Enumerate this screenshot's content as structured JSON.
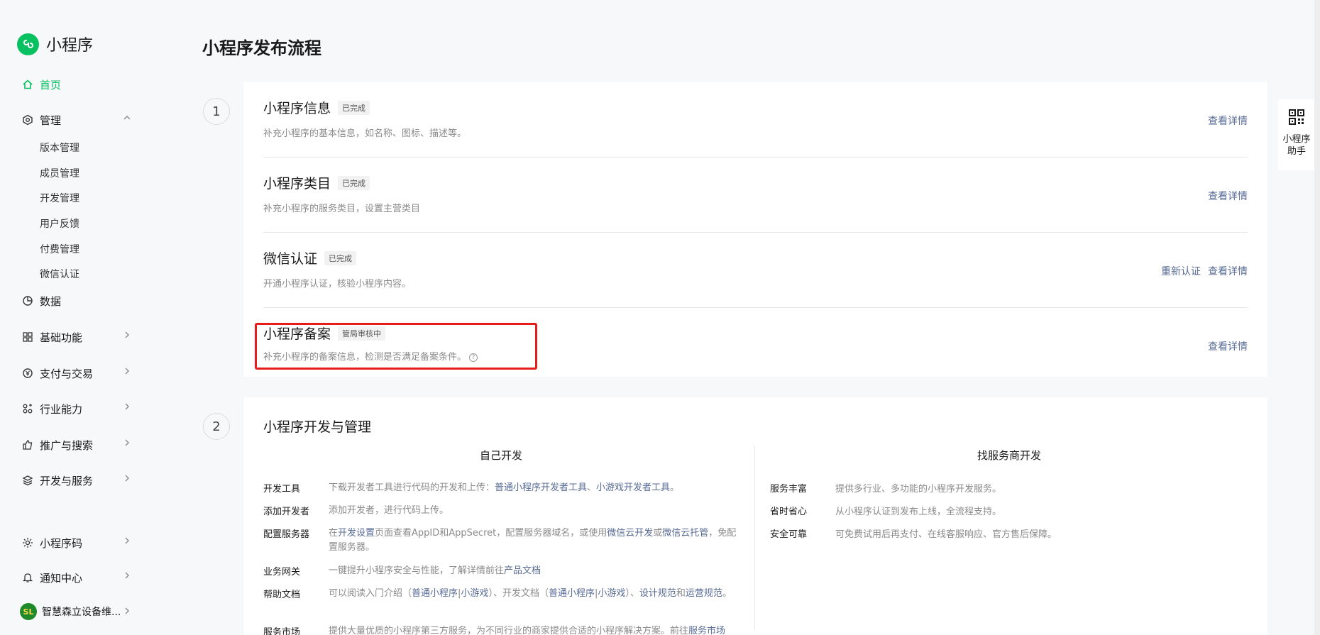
{
  "app": {
    "name": "小程序",
    "brand_color": "#07c160",
    "link_color": "#576b95"
  },
  "sidebar": {
    "home": "首页",
    "manage": "管理",
    "manage_items": [
      "版本管理",
      "成员管理",
      "开发管理",
      "用户反馈",
      "付费管理",
      "微信认证"
    ],
    "data": "数据",
    "basic": "基础功能",
    "pay": "支付与交易",
    "industry": "行业能力",
    "promo": "推广与搜索",
    "dev": "开发与服务",
    "qrcode": "小程序码",
    "notify": "通知中心",
    "account_initials": "SL",
    "account_name": "智慧森立设备维..."
  },
  "page_title": "小程序发布流程",
  "step1": {
    "number": "1",
    "rows": [
      {
        "title": "小程序信息",
        "tag": "已完成",
        "desc": "补充小程序的基本信息，如名称、图标、描述等。",
        "action": "查看详情"
      },
      {
        "title": "小程序类目",
        "tag": "已完成",
        "desc": "补充小程序的服务类目，设置主营类目",
        "action": "查看详情"
      },
      {
        "title": "微信认证",
        "tag": "已完成",
        "desc": "开通小程序认证，核验小程序内容。",
        "action_secondary": "重新认证",
        "action": "查看详情"
      },
      {
        "title": "小程序备案",
        "tag": "管局审核中",
        "desc": "补充小程序的备案信息，检测是否满足备案条件。",
        "action": "查看详情"
      }
    ]
  },
  "step2": {
    "number": "2",
    "title": "小程序开发与管理",
    "left_head": "自己开发",
    "right_head": "找服务商开发",
    "left": [
      {
        "k": "开发工具",
        "v1": "下载开发者工具进行代码的开发和上传：",
        "a1": "普通小程序开发者工具",
        "v2": "、",
        "a2": "小游戏开发者工具",
        "v3": "。"
      },
      {
        "k": "添加开发者",
        "v1": "添加开发者，进行代码上传。"
      },
      {
        "k": "配置服务器",
        "v1": "在",
        "a1": "开发设置",
        "v2": "页面查看AppID和AppSecret，配置服务器域名，或使用",
        "a2": "微信云开发",
        "v3": "或",
        "a3": "微信云托管",
        "v4": "，免配置服务器。"
      },
      {
        "k": "业务网关",
        "v1": "一键提升小程序安全与性能，了解详情前往",
        "a1": "产品文档"
      },
      {
        "k": "帮助文档",
        "v1": "可以阅读入门介绍（",
        "a1": "普通小程序",
        "v2": "|",
        "a2": "小游戏",
        "v3": "）、开发文档（",
        "a3": "普通小程序",
        "v4": "|",
        "a4": "小游戏",
        "v5": "）、",
        "a5": "设计规范",
        "v6": "和",
        "a6": "运营规范",
        "v7": "。"
      },
      {
        "k": "服务市场",
        "v1": "提供大量优质的小程序第三方服务，为不同行业的商家提供合适的小程序解决方案。前往",
        "a1": "服务市场"
      }
    ],
    "right": [
      {
        "k": "服务丰富",
        "v": "提供多行业、多功能的小程序开发服务。"
      },
      {
        "k": "省时省心",
        "v": "从小程序认证到发布上线，全流程支持。"
      },
      {
        "k": "安全可靠",
        "v": "可免费试用后再支付、在线客服响应、官方售后保障。"
      }
    ]
  },
  "assistant": {
    "label": "小程序助手"
  },
  "icons": {
    "logo": "miniprogram-logo-icon",
    "home": "home-icon",
    "manage": "gear-icon",
    "data": "pie-chart-icon",
    "basic": "apps-grid-icon",
    "pay": "yen-icon",
    "industry": "industry-icon",
    "promo": "thumb-up-icon",
    "dev": "layers-icon",
    "qrcode": "sun-icon",
    "notify": "bell-icon",
    "assistant": "qr-code-icon"
  }
}
